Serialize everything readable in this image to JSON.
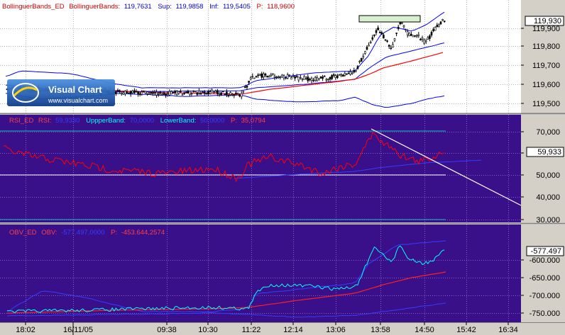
{
  "panels": {
    "price": {
      "header": {
        "name": "BollinguerBands_ED",
        "param_label": "BollinguerBands:",
        "param_value": "119,7631",
        "sup_label": "Sup:",
        "sup_value": "119,9858",
        "inf_label": "Inf:",
        "inf_value": "119,5405",
        "p_label": "P:",
        "p_value": "118,9600"
      },
      "current_value": "119,930",
      "axis_ticks": [
        "119,900",
        "119,800",
        "119,700",
        "119,600",
        "119,500"
      ],
      "logo": {
        "name": "Visual Chart",
        "url": "www.visualchart.com"
      },
      "colors": {
        "candles": "#000000",
        "bands": "#0000ff",
        "average": "#ff0000",
        "bg": "#ffffff"
      }
    },
    "rsi": {
      "header": {
        "name": "RSI_ED",
        "rsi_label": "RSI:",
        "rsi_value": "59,9330",
        "upper_label": "UppperBand:",
        "upper_value": "70,0000",
        "lower_label": "LowerBand:",
        "lower_value": "50,0000",
        "p_label": "P:",
        "p_value": "35,0794"
      },
      "current_value": "59,933",
      "axis_ticks": [
        "70,000",
        "60,000",
        "50,000",
        "40,000",
        "30,000"
      ],
      "colors": {
        "bg": "#3a0f8a",
        "line": "#ff0000",
        "avg": "#0000ff",
        "bands": "#ffffff",
        "trendline": "#ffffff"
      }
    },
    "obv": {
      "header": {
        "name": "OBV_ED",
        "obv_label": "OBV:",
        "obv_value": "-577.497,0000",
        "p_label": "P:",
        "p_value": "-453.644,2574"
      },
      "current_value": "-577.497",
      "axis_ticks": [
        "-600.000",
        "-650.000",
        "-700.000",
        "-750.000"
      ],
      "colors": {
        "bg": "#3a0f8a",
        "line": "#00ffff",
        "avg": "#ff0000",
        "bands": "#0000ff"
      }
    }
  },
  "time_axis": [
    "18:02",
    "16/11/05",
    "09:38",
    "10:30",
    "11:22",
    "12:14",
    "13:06",
    "13:58",
    "14:50",
    "15:42",
    "16:34"
  ],
  "chart_data": [
    {
      "type": "line",
      "x": [
        "18:02",
        "09:38",
        "10:30",
        "11:22",
        "12:14",
        "13:06",
        "13:58",
        "14:50"
      ],
      "series": [
        {
          "name": "BollinguerBands",
          "values": [
            119.61,
            119.6,
            119.61,
            119.61,
            119.68,
            119.72,
            119.77,
            119.81
          ]
        },
        {
          "name": "Sup",
          "values": [
            119.72,
            119.63,
            119.63,
            119.64,
            119.72,
            119.73,
            119.9,
            119.98
          ]
        },
        {
          "name": "Inf",
          "values": [
            119.51,
            119.56,
            119.57,
            119.55,
            119.53,
            119.52,
            119.48,
            119.53
          ]
        }
      ],
      "ylim": [
        119.46,
        119.96
      ]
    },
    {
      "type": "line",
      "x": [
        "18:02",
        "09:38",
        "10:30",
        "11:22",
        "12:14",
        "13:06",
        "13:58",
        "14:50"
      ],
      "series": [
        {
          "name": "RSI",
          "values": [
            58,
            51,
            55,
            52,
            55,
            54,
            69,
            60
          ]
        }
      ],
      "ylim": [
        27,
        73
      ]
    },
    {
      "type": "line",
      "x": [
        "18:02",
        "09:38",
        "10:30",
        "11:22",
        "12:14",
        "13:06",
        "13:58",
        "14:50"
      ],
      "series": [
        {
          "name": "OBV",
          "values": [
            -762000,
            -760000,
            -756000,
            -752000,
            -680000,
            -680000,
            -590000,
            -578000
          ]
        },
        {
          "name": "P",
          "values": [
            -760000,
            -758000,
            -755000,
            -752000,
            -735000,
            -720000,
            -680000,
            -660000
          ]
        }
      ],
      "ylim": [
        -790000,
        -550000
      ]
    }
  ]
}
